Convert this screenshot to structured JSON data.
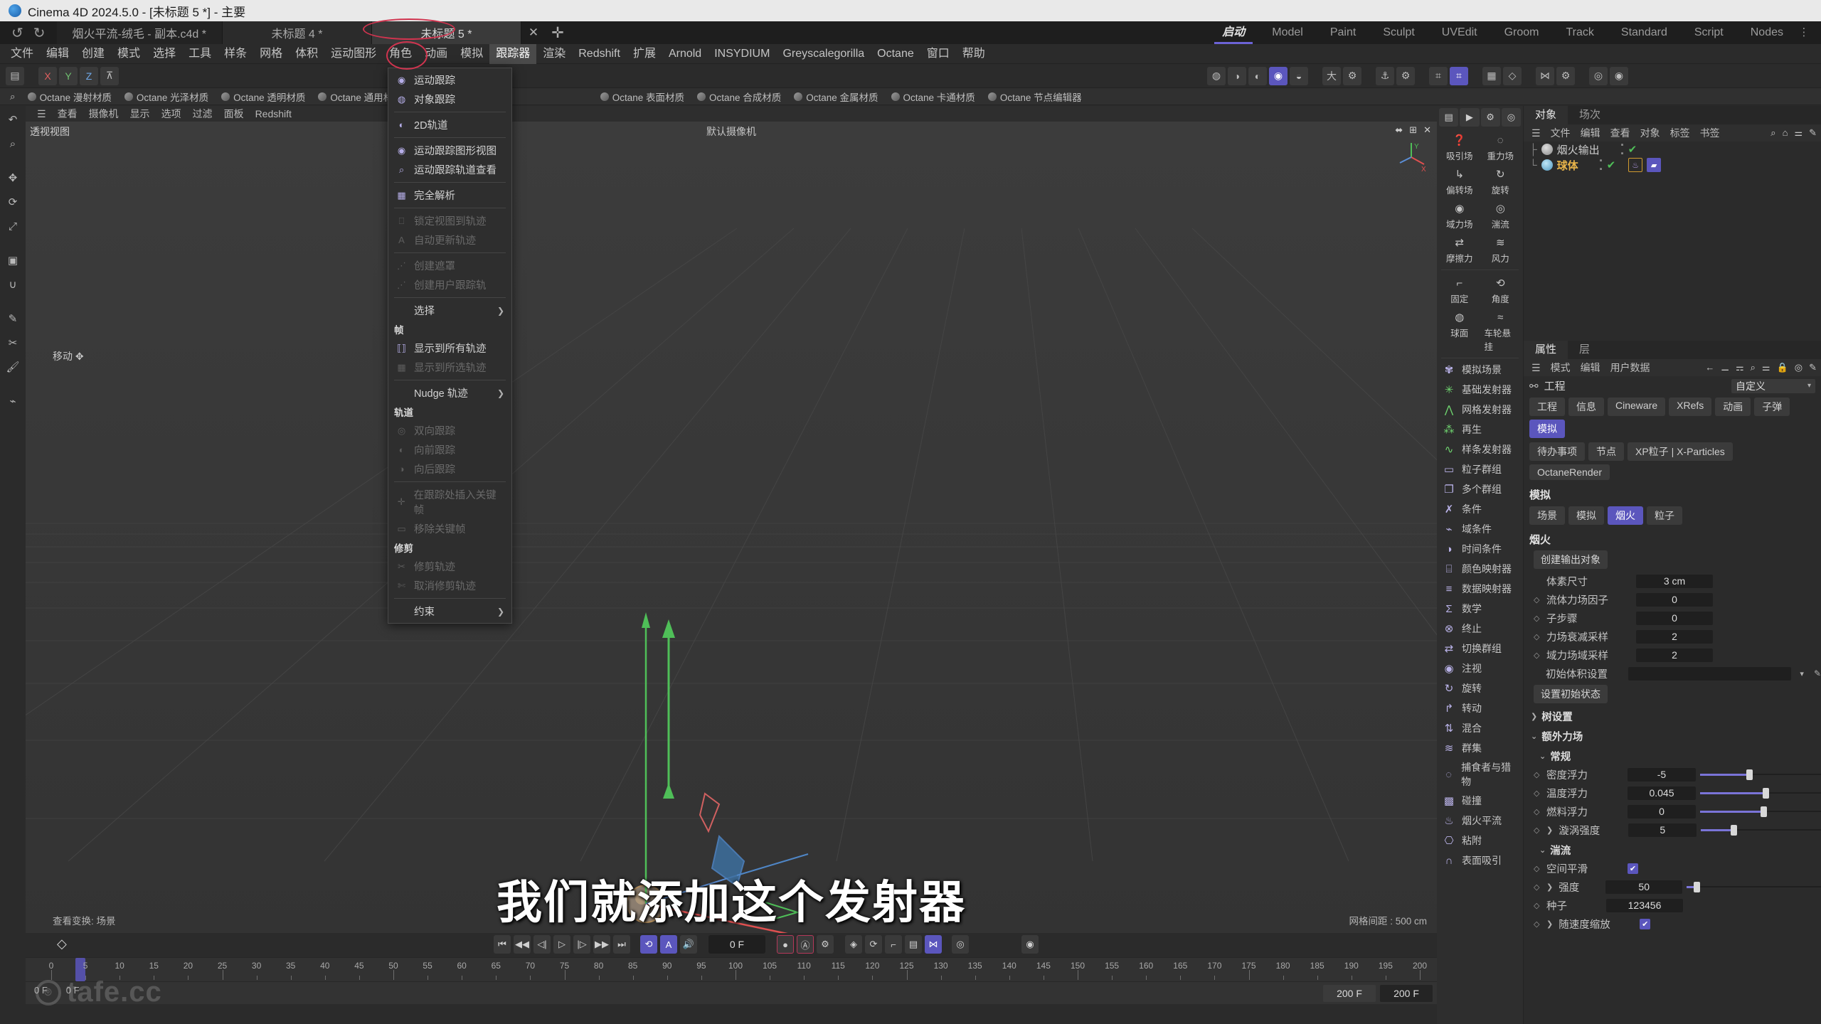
{
  "window": {
    "title": "Cinema 4D 2024.5.0 - [未标题 5 *] - 主要",
    "logo": "c4d-logo"
  },
  "doc_tabs": [
    {
      "label": "烟火平流-绒毛 - 副本.c4d *",
      "active": false
    },
    {
      "label": "未标题 4 *",
      "active": false
    },
    {
      "label": "未标题 5 *",
      "active": true
    }
  ],
  "tab_controls": {
    "undo": "↺",
    "redo": "↻",
    "close": "✕",
    "add": "✛"
  },
  "layout_modes": [
    {
      "label": "启动",
      "active": true
    },
    {
      "label": "Model",
      "active": false
    },
    {
      "label": "Paint",
      "active": false
    },
    {
      "label": "Sculpt",
      "active": false
    },
    {
      "label": "UVEdit",
      "active": false
    },
    {
      "label": "Groom",
      "active": false
    },
    {
      "label": "Track",
      "active": false
    },
    {
      "label": "Standard",
      "active": false
    },
    {
      "label": "Script",
      "active": false
    },
    {
      "label": "Nodes",
      "active": false
    }
  ],
  "menubar": [
    "文件",
    "编辑",
    "创建",
    "模式",
    "选择",
    "工具",
    "样条",
    "网格",
    "体积",
    "运动图形",
    "角色",
    "动画",
    "模拟",
    "跟踪器",
    "渲染",
    "Redshift",
    "扩展",
    "Arnold",
    "INSYDIUM",
    "Greyscalegorilla",
    "Octane",
    "窗口",
    "帮助"
  ],
  "menubar_open": "跟踪器",
  "toolbar": {
    "left": [
      "undo-icon",
      "axis-x",
      "axis-y",
      "axis-z",
      "axis-lock-icon"
    ],
    "axis_labels": [
      "X",
      "Y",
      "Z"
    ],
    "right_tools": [
      "render-view-icon",
      "render-region-icon",
      "render-picture-icon",
      "render-settings-icon",
      "octane-render-icon",
      "character-icon",
      "gear-icon",
      "anchor-icon",
      "gear2-icon",
      "snap-icon",
      "snap-grid-icon",
      "quantize-icon",
      "mirror-icon",
      "gear3-icon",
      "target-icon",
      "camera-icon"
    ]
  },
  "material_bar": [
    "Octane 漫射材质",
    "Octane 光泽材质",
    "Octane 透明材质",
    "Octane 通用材质",
    "Octane 表面材质",
    "Octane 合成材质",
    "Octane 金属材质",
    "Octane 卡通材质",
    "Octane 节点编辑器"
  ],
  "tracker_menu": {
    "items": [
      {
        "label": "运动跟踪",
        "icon": "motion-tracker-icon",
        "disabled": false,
        "submenu": false
      },
      {
        "label": "对象跟踪",
        "icon": "object-tracker-icon",
        "disabled": false,
        "submenu": false
      },
      {
        "sep": true
      },
      {
        "label": "2D轨道",
        "icon": "2d-track-icon",
        "disabled": false,
        "submenu": false
      },
      {
        "sep": true
      },
      {
        "label": "运动跟踪图形视图",
        "icon": "graph-view-icon",
        "disabled": false,
        "submenu": false
      },
      {
        "label": "运动跟踪轨道查看",
        "icon": "track-view-icon",
        "disabled": false,
        "submenu": false
      },
      {
        "sep": true
      },
      {
        "label": "完全解析",
        "icon": "full-solve-icon",
        "disabled": false,
        "submenu": false
      },
      {
        "sep": true
      },
      {
        "label": "锁定视图到轨迹",
        "icon": "lock-view-icon",
        "disabled": true,
        "submenu": false
      },
      {
        "label": "自动更新轨迹",
        "icon": "auto-update-icon",
        "disabled": true,
        "submenu": false
      },
      {
        "sep": true
      },
      {
        "label": "创建遮罩",
        "icon": "create-mask-icon",
        "disabled": true,
        "submenu": false
      },
      {
        "label": "创建用户跟踪轨",
        "icon": "create-user-track-icon",
        "disabled": true,
        "submenu": false
      },
      {
        "sep": true
      },
      {
        "label": "选择",
        "icon": "",
        "disabled": false,
        "submenu": true
      },
      {
        "header": "帧"
      },
      {
        "label": "显示到所有轨迹",
        "icon": "show-all-tracks-icon",
        "disabled": false,
        "submenu": false
      },
      {
        "label": "显示到所选轨迹",
        "icon": "show-selected-tracks-icon",
        "disabled": true,
        "submenu": false
      },
      {
        "sep": true
      },
      {
        "label": "Nudge 轨迹",
        "icon": "",
        "disabled": false,
        "submenu": true
      },
      {
        "header": "轨道"
      },
      {
        "label": "双向跟踪",
        "icon": "bidirectional-track-icon",
        "disabled": true,
        "submenu": false
      },
      {
        "label": "向前跟踪",
        "icon": "forward-track-icon",
        "disabled": true,
        "submenu": false
      },
      {
        "label": "向后跟踪",
        "icon": "backward-track-icon",
        "disabled": true,
        "submenu": false
      },
      {
        "sep": true
      },
      {
        "label": "在跟踪处插入关键帧",
        "icon": "insert-keyframe-icon",
        "disabled": true,
        "submenu": false
      },
      {
        "label": "移除关键帧",
        "icon": "remove-keyframe-icon",
        "disabled": true,
        "submenu": false
      },
      {
        "header": "修剪"
      },
      {
        "label": "修剪轨迹",
        "icon": "trim-track-icon",
        "disabled": true,
        "submenu": false
      },
      {
        "label": "取消修剪轨迹",
        "icon": "untrim-track-icon",
        "disabled": true,
        "submenu": false
      },
      {
        "sep": true
      },
      {
        "label": "约束",
        "icon": "",
        "disabled": false,
        "submenu": true
      }
    ]
  },
  "viewport": {
    "menu": [
      "查看",
      "摄像机",
      "显示",
      "选项",
      "过滤",
      "面板",
      "Redshift"
    ],
    "label": "透视视图",
    "camera": "默认摄像机",
    "move_hint": "移动",
    "status_left": "查看变换: 场景",
    "status_right": "网格间距 : 500 cm",
    "subtitle": "我们就添加这个发射器"
  },
  "timeline": {
    "current_frame": "0 F",
    "start_frame": "0 F",
    "end_frame": "200 F",
    "preview_end": "200 F",
    "ticks": [
      0,
      5,
      10,
      15,
      20,
      25,
      30,
      35,
      40,
      45,
      50,
      55,
      60,
      65,
      70,
      75,
      80,
      85,
      90,
      95,
      100,
      105,
      110,
      115,
      120,
      125,
      130,
      135,
      140,
      145,
      150,
      155,
      160,
      165,
      170,
      175,
      180,
      185,
      190,
      195,
      200
    ],
    "transport": [
      "go-to-start-icon",
      "prev-keyframe-icon",
      "prev-frame-icon",
      "play-icon",
      "next-frame-icon",
      "next-keyframe-icon",
      "go-to-end-icon"
    ],
    "toggles": [
      "loop-icon",
      "autokey-icon",
      "sound-icon"
    ],
    "record": [
      "record-icon",
      "autokey-record-icon",
      "keyframe-settings-icon"
    ],
    "key_tools": [
      "position-key-icon",
      "rotation-key-icon",
      "scale-key-icon",
      "param-key-icon",
      "point-level-key-icon",
      "dynamics-key-icon"
    ]
  },
  "sim_palette": {
    "top_icons": [
      "sim-scene-icon",
      "sim-play-icon",
      "sim-settings-icon",
      "sim-cache-icon"
    ],
    "force_grid": [
      {
        "label": "吸引场",
        "icon": "attractor-icon"
      },
      {
        "label": "重力场",
        "icon": "gravity-icon"
      },
      {
        "label": "偏转场",
        "icon": "deflector-icon"
      },
      {
        "label": "旋转",
        "icon": "rotation-icon"
      },
      {
        "label": "域力场",
        "icon": "field-force-icon"
      },
      {
        "label": "湍流",
        "icon": "turbulence-icon"
      },
      {
        "label": "摩擦力",
        "icon": "friction-icon"
      },
      {
        "label": "风力",
        "icon": "wind-icon"
      }
    ],
    "constraint_grid": [
      {
        "label": "固定",
        "icon": "fixed-icon"
      },
      {
        "label": "角度",
        "icon": "angle-icon"
      },
      {
        "label": "球面",
        "icon": "spherical-icon"
      },
      {
        "label": "车轮悬挂",
        "icon": "wheel-suspension-icon"
      }
    ],
    "list": [
      {
        "label": "模拟场景",
        "icon": "sim-scene-node-icon",
        "color": "#b9b2e8"
      },
      {
        "label": "基础发射器",
        "icon": "basic-emitter-icon",
        "color": "#6fd46f"
      },
      {
        "label": "网格发射器",
        "icon": "mesh-emitter-icon",
        "color": "#6fd46f"
      },
      {
        "label": "再生",
        "icon": "regenerate-icon",
        "color": "#6fd46f"
      },
      {
        "label": "样条发射器",
        "icon": "spline-emitter-icon",
        "color": "#6fd46f"
      },
      {
        "label": "粒子群组",
        "icon": "particle-group-icon",
        "color": "#b9b2e8"
      },
      {
        "label": "多个群组",
        "icon": "multi-group-icon",
        "color": "#b9b2e8"
      },
      {
        "label": "条件",
        "icon": "condition-icon",
        "color": "#b9b2e8"
      },
      {
        "label": "域条件",
        "icon": "field-condition-icon",
        "color": "#b9b2e8"
      },
      {
        "label": "时间条件",
        "icon": "time-condition-icon",
        "color": "#b9b2e8"
      },
      {
        "label": "颜色映射器",
        "icon": "color-mapper-icon",
        "color": "#b9b2e8"
      },
      {
        "label": "数据映射器",
        "icon": "data-mapper-icon",
        "color": "#b9b2e8"
      },
      {
        "label": "数学",
        "icon": "math-icon",
        "color": "#b9b2e8"
      },
      {
        "label": "终止",
        "icon": "terminate-icon",
        "color": "#b9b2e8"
      },
      {
        "label": "切换群组",
        "icon": "switch-group-icon",
        "color": "#b9b2e8"
      },
      {
        "label": "注视",
        "icon": "look-at-icon",
        "color": "#b9b2e8"
      },
      {
        "label": "旋转",
        "icon": "spin-icon",
        "color": "#b9b2e8"
      },
      {
        "label": "转动",
        "icon": "turn-icon",
        "color": "#b9b2e8"
      },
      {
        "label": "混合",
        "icon": "blend-icon",
        "color": "#b9b2e8"
      },
      {
        "label": "群集",
        "icon": "flock-icon",
        "color": "#b9b2e8"
      },
      {
        "label": "捕食者与猎物",
        "icon": "predator-prey-icon",
        "color": "#b9b2e8"
      },
      {
        "label": "碰撞",
        "icon": "collision-icon",
        "color": "#b9b2e8"
      },
      {
        "label": "烟火平流",
        "icon": "pyro-advection-icon",
        "color": "#b9b2e8"
      },
      {
        "label": "粘附",
        "icon": "stick-icon",
        "color": "#b9b2e8"
      },
      {
        "label": "表面吸引",
        "icon": "surface-attract-icon",
        "color": "#b9b2e8"
      }
    ]
  },
  "object_manager": {
    "tabs": [
      {
        "label": "对象",
        "active": true
      },
      {
        "label": "场次",
        "active": false
      }
    ],
    "menu": [
      "文件",
      "编辑",
      "查看",
      "对象",
      "标签",
      "书签"
    ],
    "right_icons": [
      "search-icon",
      "home-icon",
      "filter-icon",
      "edit-icon"
    ],
    "objects": [
      {
        "name": "烟火输出",
        "selected": false,
        "icon_color": "#c8c8c8",
        "visible": true,
        "tags": []
      },
      {
        "name": "球体",
        "selected": true,
        "icon_color": "#79c8e8",
        "visible": true,
        "tags": [
          "pyro-tag",
          "field-tag"
        ]
      }
    ]
  },
  "attributes": {
    "tabs": [
      {
        "label": "属性",
        "active": true
      },
      {
        "label": "层",
        "active": false
      }
    ],
    "menu": [
      "模式",
      "编辑",
      "用户数据"
    ],
    "right_icons": [
      "back-arrow-icon",
      "pin-icon",
      "pin2-icon",
      "search-icon",
      "filter-icon",
      "lock-icon",
      "target-icon",
      "edit-icon"
    ],
    "object_title": "工程",
    "preset_dropdown": "自定义",
    "tabs_row1": [
      {
        "label": "工程",
        "active": false
      },
      {
        "label": "信息",
        "active": false
      },
      {
        "label": "Cineware",
        "active": false
      },
      {
        "label": "XRefs",
        "active": false
      },
      {
        "label": "动画",
        "active": false
      },
      {
        "label": "子弹",
        "active": false
      },
      {
        "label": "模拟",
        "active": true
      }
    ],
    "tabs_row2": [
      {
        "label": "待办事项",
        "active": false
      },
      {
        "label": "节点",
        "active": false
      },
      {
        "label": "XP粒子 | X-Particles",
        "active": false
      },
      {
        "label": "OctaneRender",
        "active": false
      }
    ],
    "section_title": "模拟",
    "sim_tabs": [
      {
        "label": "场景",
        "active": false
      },
      {
        "label": "模拟",
        "active": false
      },
      {
        "label": "烟火",
        "active": true
      },
      {
        "label": "粒子",
        "active": false
      }
    ],
    "pyro_title": "烟火",
    "create_output_button": "创建输出对象",
    "fields": [
      {
        "label": "体素尺寸",
        "value": "3 cm",
        "keyable": false
      },
      {
        "label": "流体力场因子",
        "value": "0",
        "keyable": true
      },
      {
        "label": "子步骤",
        "value": "0",
        "keyable": true
      },
      {
        "label": "力场衰减采样",
        "value": "2",
        "keyable": true
      },
      {
        "label": "域力场域采样",
        "value": "2",
        "keyable": true
      }
    ],
    "initial_volume_label": "初始体积设置",
    "initial_volume_value": "",
    "set_initial_state_button": "设置初始状态",
    "tree_settings_group": "树设置",
    "extra_force_group": "额外力场",
    "general_group": "常规",
    "general_fields": [
      {
        "label": "密度浮力",
        "value": "-5",
        "fill": 38,
        "knob": 38
      },
      {
        "label": "温度浮力",
        "value": "0.045",
        "fill": 52,
        "knob": 52
      },
      {
        "label": "燃料浮力",
        "value": "0",
        "fill": 50,
        "knob": 50
      },
      {
        "label": "漩涡强度",
        "value": "5",
        "fill": 25,
        "knob": 25,
        "expand": true
      }
    ],
    "turbulence_group": "湍流",
    "turbulence_fields": [
      {
        "label": "空间平滑",
        "type": "checkbox",
        "checked": true
      },
      {
        "label": "强度",
        "type": "slider",
        "value": "50",
        "fill": 4,
        "knob": 4,
        "expand": true
      },
      {
        "label": "种子",
        "type": "number",
        "value": "123456"
      },
      {
        "label": "随速度缩放",
        "type": "checkbox",
        "checked": true,
        "expand": true
      }
    ]
  },
  "watermark": {
    "text": "tafe.cc"
  },
  "colors": {
    "accent": "#5b56bd",
    "highlight": "#d0344f",
    "check": "#4fbf58",
    "select": "#e8b44a"
  }
}
